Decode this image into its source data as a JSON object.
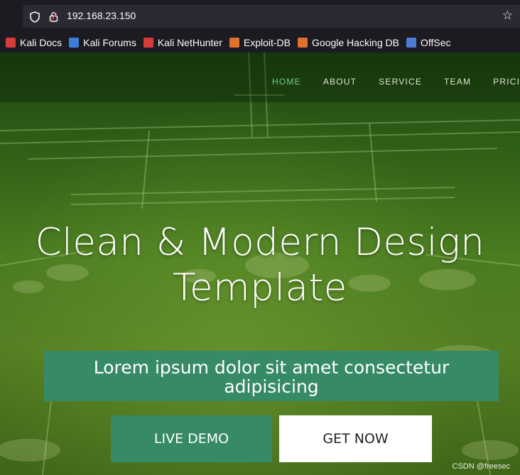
{
  "browser": {
    "url": "192.168.23.150",
    "bookmarks": [
      {
        "label": "Kali Docs",
        "icon": "kali-docs-icon",
        "color": "#d73b3b"
      },
      {
        "label": "Kali Forums",
        "icon": "kali-forums-icon",
        "color": "#3b7dd8"
      },
      {
        "label": "Kali NetHunter",
        "icon": "kali-nethunter-icon",
        "color": "#d73b3b"
      },
      {
        "label": "Exploit-DB",
        "icon": "exploit-db-icon",
        "color": "#e0702d"
      },
      {
        "label": "Google Hacking DB",
        "icon": "ghdb-icon",
        "color": "#e0702d"
      },
      {
        "label": "OffSec",
        "icon": "offsec-icon",
        "color": "#4e7bd6"
      }
    ]
  },
  "nav": {
    "items": [
      "HOME",
      "ABOUT",
      "SERVICE",
      "TEAM",
      "PRICING"
    ],
    "active": "HOME"
  },
  "hero": {
    "title_line1": "Clean & Modern Design",
    "title_line2": "Template",
    "subtitle_line1": "Lorem ipsum dolor sit amet consectetur",
    "subtitle_line2": "adipisicing",
    "buttons": {
      "live_demo": "LIVE DEMO",
      "get_now": "GET NOW"
    }
  },
  "watermark": "CSDN @freesec",
  "colors": {
    "accent": "#378a66",
    "nav_active": "#6fcf97"
  }
}
